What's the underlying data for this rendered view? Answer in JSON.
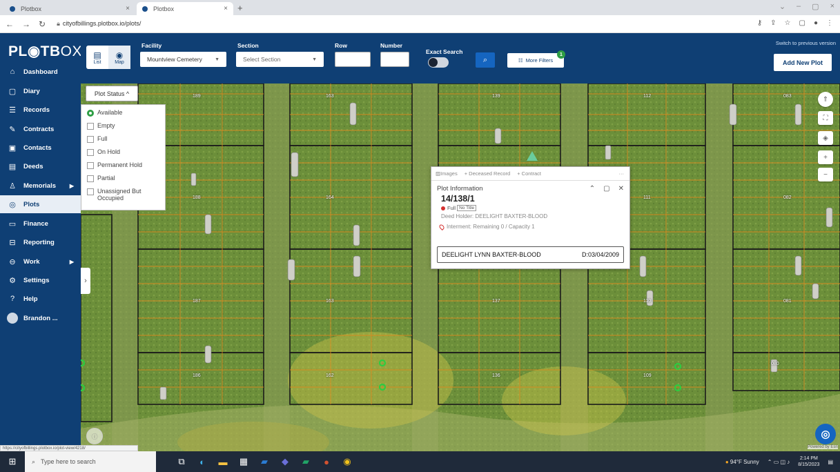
{
  "browser": {
    "tabs": [
      {
        "label": "Plotbox"
      },
      {
        "label": "Plotbox"
      }
    ],
    "url": "cityofbillings.plotbox.io/plots/",
    "status_url": "https://cityofbillings.plotbox.io/plot-view/4218/"
  },
  "sidebar": {
    "logo_bold": "PL",
    "logo_mid": "TB",
    "logo_thin": "OX",
    "items": [
      {
        "label": "Dashboard",
        "icon": "⌂"
      },
      {
        "label": "Diary",
        "icon": "▢"
      },
      {
        "label": "Records",
        "icon": "☰"
      },
      {
        "label": "Contracts",
        "icon": "✎"
      },
      {
        "label": "Contacts",
        "icon": "▣"
      },
      {
        "label": "Deeds",
        "icon": "▤"
      },
      {
        "label": "Memorials",
        "icon": "♙"
      },
      {
        "label": "Plots",
        "icon": "◎"
      },
      {
        "label": "Finance",
        "icon": "▭"
      },
      {
        "label": "Reporting",
        "icon": "⊟"
      },
      {
        "label": "Work",
        "icon": "⊖"
      },
      {
        "label": "Settings",
        "icon": "⚙"
      },
      {
        "label": "Help",
        "icon": "?"
      },
      {
        "label": "Brandon ..."
      }
    ]
  },
  "toolbar": {
    "view_list": "List",
    "view_map": "Map",
    "facility_label": "Facility",
    "facility_value": "Mountview Cemetery",
    "section_label": "Section",
    "section_placeholder": "Select Section",
    "row_label": "Row",
    "number_label": "Number",
    "exact_search_label": "Exact Search",
    "more_filters": "More Filters",
    "filters_count": "1",
    "switch_link": "Switch to previous version",
    "add_plot": "Add New Plot"
  },
  "plot_status": {
    "button": "Plot Status ^",
    "options": [
      "Available",
      "Empty",
      "Full",
      "On Hold",
      "Permanent Hold",
      "Partial",
      "Unassigned But Occupied"
    ]
  },
  "map": {
    "plot_numbers": [
      "189",
      "163",
      "139",
      "112",
      "083",
      "188",
      "164",
      "111",
      "082",
      "187",
      "163",
      "137",
      "110",
      "081",
      "186",
      "162",
      "136",
      "109",
      "080"
    ]
  },
  "popup": {
    "tab_images": "Images",
    "tab_record": "+ Deceased Record",
    "tab_contract": "+ Contract",
    "more": "···",
    "title": "Plot Information",
    "plot_id": "14/138/1",
    "status": "Full",
    "status_tag": "No Title",
    "deed_holder": "Deed Holder: DEELIGHT BAXTER-BLOOD",
    "interment": "Interment: Remaining 0 / Capacity 1",
    "occupant_name": "DEELIGHT LYNN BAXTER-BLOOD",
    "occupant_date": "D:03/04/2009"
  },
  "footer": {
    "powered_by": "Powered by Esri"
  },
  "taskbar": {
    "search_placeholder": "Type here to search",
    "weather": "94°F Sunny",
    "time": "2:14 PM",
    "date": "8/15/2023"
  },
  "colors": {
    "brand": "#0f3f74",
    "accent": "#1565c0",
    "available": "#2e9e44",
    "full": "#d3302f"
  }
}
